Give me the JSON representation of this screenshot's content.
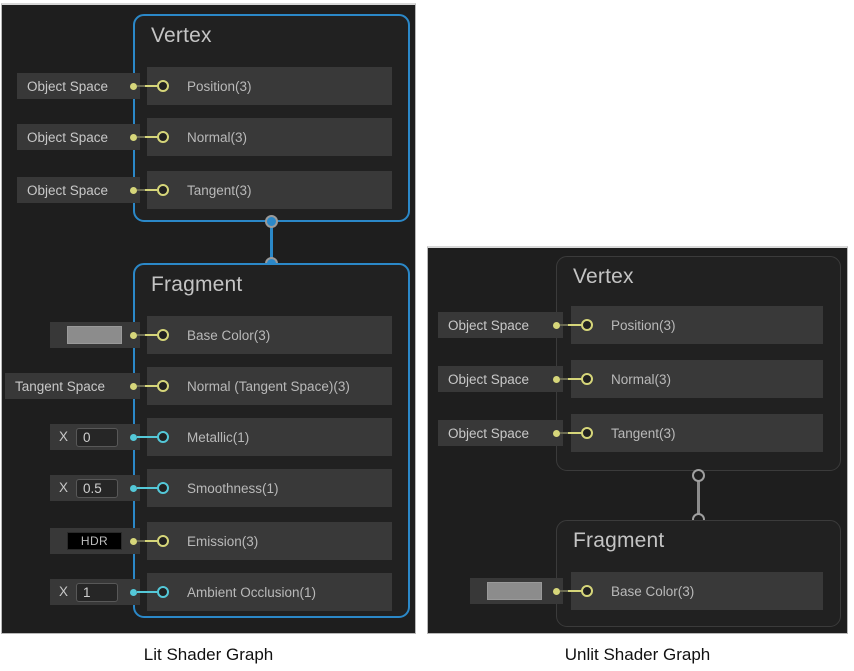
{
  "captions": {
    "lit": "Lit Shader Graph",
    "unlit": "Unlit Shader Graph"
  },
  "colors": {
    "panel_background": "#1e1e1e",
    "stack_background": "#212121",
    "stack_border_lit": "#2b88c8",
    "stack_border_unlit": "#3b3b3b",
    "block_row_background": "#393939",
    "port_vector3": "#d6d67a",
    "port_vector1": "#54c8d8",
    "connector_lit": "#2b88c8",
    "connector_unlit": "#8c8c8c",
    "base_color_swatch": "#8c8c8c",
    "emission_swatch": "#000000",
    "text_primary": "#c4c4c4",
    "text_secondary": "#b9b9b9"
  },
  "lit_graph": {
    "vertex": {
      "title": "Vertex",
      "blocks": [
        {
          "label": "Position(3)",
          "default_type": "dropdown",
          "default_value": "Object Space",
          "port_type": "vector3"
        },
        {
          "label": "Normal(3)",
          "default_type": "dropdown",
          "default_value": "Object Space",
          "port_type": "vector3"
        },
        {
          "label": "Tangent(3)",
          "default_type": "dropdown",
          "default_value": "Object Space",
          "port_type": "vector3"
        }
      ]
    },
    "fragment": {
      "title": "Fragment",
      "blocks": [
        {
          "label": "Base Color(3)",
          "default_type": "color",
          "default_value": "#8c8c8c",
          "port_type": "vector3"
        },
        {
          "label": "Normal (Tangent Space)(3)",
          "default_type": "dropdown",
          "default_value": "Tangent Space",
          "port_type": "vector3"
        },
        {
          "label": "Metallic(1)",
          "default_type": "float",
          "default_value": "0",
          "axis_label": "X",
          "port_type": "vector1"
        },
        {
          "label": "Smoothness(1)",
          "default_type": "float",
          "default_value": "0.5",
          "axis_label": "X",
          "port_type": "vector1"
        },
        {
          "label": "Emission(3)",
          "default_type": "hdr",
          "default_value": "HDR",
          "port_type": "vector3"
        },
        {
          "label": "Ambient Occlusion(1)",
          "default_type": "float",
          "default_value": "1",
          "axis_label": "X",
          "port_type": "vector1"
        }
      ]
    }
  },
  "unlit_graph": {
    "vertex": {
      "title": "Vertex",
      "blocks": [
        {
          "label": "Position(3)",
          "default_type": "dropdown",
          "default_value": "Object Space",
          "port_type": "vector3"
        },
        {
          "label": "Normal(3)",
          "default_type": "dropdown",
          "default_value": "Object Space",
          "port_type": "vector3"
        },
        {
          "label": "Tangent(3)",
          "default_type": "dropdown",
          "default_value": "Object Space",
          "port_type": "vector3"
        }
      ]
    },
    "fragment": {
      "title": "Fragment",
      "blocks": [
        {
          "label": "Base Color(3)",
          "default_type": "color",
          "default_value": "#8c8c8c",
          "port_type": "vector3"
        }
      ]
    }
  }
}
